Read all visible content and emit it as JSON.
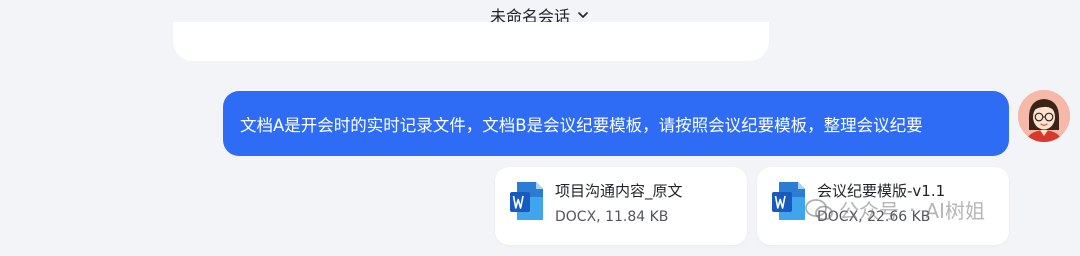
{
  "header": {
    "title": "未命名会话",
    "dropdown_icon": "chevron-down-icon"
  },
  "conversation": {
    "user_message": "文档A是开会时的实时记录文件，文档B是会议纪要模板，请按照会议纪要模板，整理会议纪要",
    "user_avatar": "avatar-cartoon-woman",
    "attachments": [
      {
        "name": "项目沟通内容_原文",
        "meta": "DOCX, 11.84 KB",
        "icon": "word-doc-icon"
      },
      {
        "name": "会议纪要模版-v1.1",
        "meta": "DOCX, 22.66 KB",
        "icon": "word-doc-icon"
      }
    ]
  },
  "watermark": {
    "prefix": "公众号",
    "separator": "·",
    "name": "AI树姐",
    "icon": "wechat-icon"
  },
  "colors": {
    "accent": "#2E6CF6",
    "background": "#F3F4F8",
    "card": "#FFFFFF",
    "word_blue": "#185ABD"
  }
}
